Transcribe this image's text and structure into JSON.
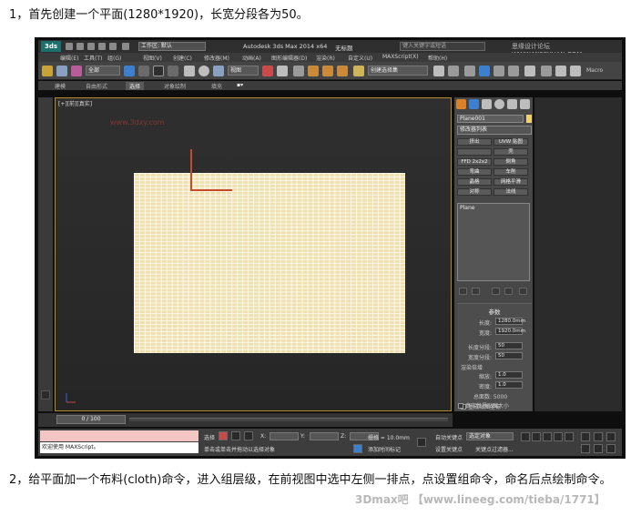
{
  "captions": {
    "top": "1，首先创建一个平面(1280*1920)，长宽分段各为50。",
    "bottom": "2，给平面加一个布料(cloth)命令，进入组层级，在前视图中选中左侧一排点，点设置组命令，命名后点绘制命令。"
  },
  "window": {
    "logo": "3ds",
    "workspace": "工作区: 默认",
    "app_title": "Autodesk 3ds Max  2014 x64",
    "doc_title": "无标题",
    "search_placeholder": "键入关键字或短语",
    "watermark": "思缘设计论坛 WWW.MISSYUAN.COM"
  },
  "menubar": [
    "编辑(E)",
    "工具(T)",
    "组(G)",
    "视图(V)",
    "创建(C)",
    "修改器(M)",
    "动画(A)",
    "图形编辑器(D)",
    "渲染(R)",
    "自定义(U)",
    "MAXScript(X)",
    "帮助(H)"
  ],
  "toolbar": {
    "filter_dropdown": "全部",
    "view_dropdown": "视图",
    "selection_set": "创建选择集",
    "macro": "Macro"
  },
  "ribbon": {
    "tabs": [
      "建模",
      "自由形式",
      "选择",
      "对象绘制",
      "填充"
    ],
    "active": "选择"
  },
  "viewport": {
    "label": "[+][前][真实]",
    "watermark": "www.3dxy.com"
  },
  "command_panel": {
    "object_name": "Plane001",
    "modifier_list": "修改器列表",
    "modifier_buttons": [
      "挤出",
      "UVW 贴图",
      "",
      "壳",
      "FFD 2x2x2",
      "倒角",
      "弯曲",
      "车削",
      "晶格",
      "网格平滑",
      "对称",
      "法线"
    ],
    "stack_item": "Plane",
    "params_title": "参数",
    "params": [
      {
        "label": "长度:",
        "value": "1280.0mm"
      },
      {
        "label": "宽度:",
        "value": "1920.0mm"
      },
      {
        "label": "长度分段:",
        "value": "50"
      },
      {
        "label": "宽度分段:",
        "value": "50"
      }
    ],
    "render_multipliers": "渲染倍增",
    "multipliers": [
      {
        "label": "缩放:",
        "value": "1.0"
      },
      {
        "label": "密度:",
        "value": "1.0"
      }
    ],
    "total_faces": "总面数: 5000",
    "checks": [
      "生成贴图坐标",
      "真实世界贴图大小"
    ]
  },
  "timeline": {
    "slider": "0 / 100"
  },
  "statusbar": {
    "maxscript_welcome": "欢迎使用 MAXScript。",
    "selection_label": "选择",
    "hint": "单击或单击并拖动以选择对象",
    "x_label": "X:",
    "y_label": "Y:",
    "z_label": "Z:",
    "grid": "栅格 = 10.0mm",
    "add_time_tag": "添加时间标记",
    "auto_key": "自动关键点",
    "selected_object": "选定对象",
    "set_key": "设置关键点",
    "key_filters": "关键点过滤器..."
  },
  "watermark_bottom": "3Dmax吧 【www.lineeg.com/tieba/1771】",
  "colors": {
    "plane": "#efe0ad",
    "viewport_border": "#b78a2c",
    "gizmo": "#c74a2a"
  }
}
